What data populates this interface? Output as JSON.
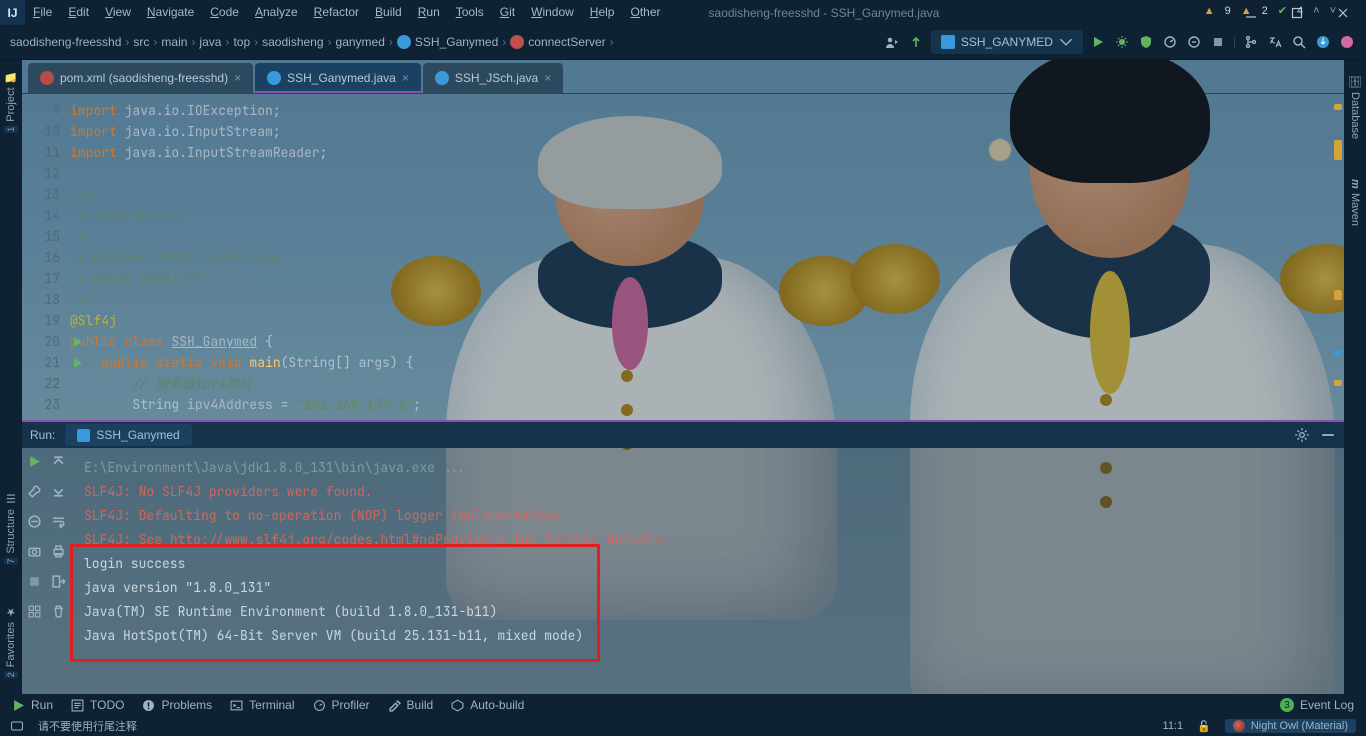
{
  "window": {
    "title": "saodisheng-freesshd - SSH_Ganymed.java",
    "menus": [
      "File",
      "Edit",
      "View",
      "Navigate",
      "Code",
      "Analyze",
      "Refactor",
      "Build",
      "Run",
      "Tools",
      "Git",
      "Window",
      "Help",
      "Other"
    ]
  },
  "breadcrumbs": {
    "items": [
      "saodisheng-freesshd",
      "src",
      "main",
      "java",
      "top",
      "saodisheng",
      "ganymed",
      "SSH_Ganymed",
      "connectServer"
    ]
  },
  "run_config": {
    "name": "SSH_GANYMED"
  },
  "tabs": [
    {
      "label": "pom.xml (saodisheng-freesshd)",
      "icon": "m",
      "active": false
    },
    {
      "label": "SSH_Ganymed.java",
      "icon": "c",
      "active": true
    },
    {
      "label": "SSH_JSch.java",
      "icon": "c",
      "active": false
    }
  ],
  "inspections": {
    "warnA": "9",
    "warnB": "2",
    "okA": "4"
  },
  "code": {
    "first_line_no": 9,
    "lines": [
      {
        "n": 9,
        "html": "<span class='kw'>import</span> <span class='pkg'>java.io.IOException</span>;"
      },
      {
        "n": 10,
        "html": "<span class='kw'>import</span> <span class='pkg'>java.io.InputStream</span>;"
      },
      {
        "n": 11,
        "html": "<span class='kw'>import</span> <span class='pkg'>java.io.InputStreamReader</span>;"
      },
      {
        "n": 12,
        "html": ""
      },
      {
        "n": 13,
        "html": "<span class='doc'>/**</span>"
      },
      {
        "n": 14,
        "html": "<span class='doc'> * description:</span>"
      },
      {
        "n": 15,
        "html": "<span class='doc'> *</span>"
      },
      {
        "n": 16,
        "html": "<span class='doc'> * @author 扫地生_saodisheng</span>"
      },
      {
        "n": 17,
        "html": "<span class='doc'> * @date 2021/7/7</span>"
      },
      {
        "n": 18,
        "html": "<span class='doc'> */</span>"
      },
      {
        "n": 19,
        "html": "<span class='ann'>@Slf4j</span>"
      },
      {
        "n": 20,
        "run": true,
        "html": "<span class='kw'>public class</span> <span class='cls underline'>SSH_Ganymed</span> {"
      },
      {
        "n": 21,
        "run": true,
        "html": "    <span class='kw'>public static void</span> <span class='fn'>main</span>(String[] args) {"
      },
      {
        "n": 22,
        "html": "        <span class='cmt'>// 服务器ipv4地址</span>"
      },
      {
        "n": 23,
        "html": "        String <span class='id'>ipv4Address</span> = <span class='str'>\"192.168.137.1\"</span>;"
      }
    ]
  },
  "run": {
    "title": "Run:",
    "tab": "SSH_Ganymed",
    "lines": [
      {
        "cls": "cmd",
        "text": "E:\\Environment\\Java\\jdk1.8.0_131\\bin\\java.exe ..."
      },
      {
        "cls": "err",
        "text": "SLF4J: No SLF4J providers were found."
      },
      {
        "cls": "err",
        "text": "SLF4J: Defaulting to no-operation (NOP) logger implementation"
      },
      {
        "cls": "err",
        "html": "SLF4J: See <span class='link'>http://www.slf4j.org/codes.html#noProviders</span> for further details."
      },
      {
        "cls": "out",
        "text": "login success"
      },
      {
        "cls": "out",
        "text": "java version \"1.8.0_131\""
      },
      {
        "cls": "out",
        "text": "Java(TM) SE Runtime Environment (build 1.8.0_131-b11)"
      },
      {
        "cls": "out",
        "text": "Java HotSpot(TM) 64-Bit Server VM (build 25.131-b11, mixed mode)"
      }
    ]
  },
  "bottom_tools": {
    "run": "Run",
    "todo": "TODO",
    "problems": "Problems",
    "terminal": "Terminal",
    "profiler": "Profiler",
    "build": "Build",
    "autobuild": "Auto-build",
    "eventlog": "Event Log",
    "event_badge": "3"
  },
  "status": {
    "message": "请不要使用行尾注释",
    "caret": "11:1",
    "theme": "Night Owl (Material)"
  },
  "leftstrip": {
    "project": "Project",
    "structure": "Structure",
    "favorites": "Favorites"
  },
  "rightstrip": {
    "database": "Database",
    "maven": "Maven"
  }
}
